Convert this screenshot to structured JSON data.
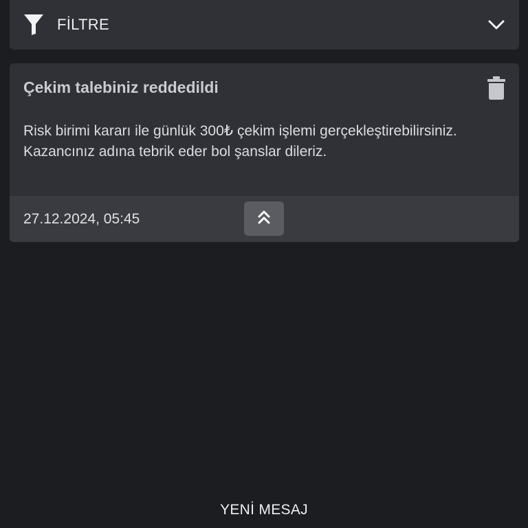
{
  "filter": {
    "label": "FİLTRE",
    "icon": "filter-icon",
    "toggle_icon": "chevron-down-icon"
  },
  "message": {
    "title": "Çekim talebiniz reddedildi",
    "body": "Risk birimi kararı ile günlük 300₺ çekim işlemi gerçekleştirebilirsiniz. Kazancınız adına tebrik eder bol şanslar dileriz.",
    "timestamp": "27.12.2024, 05:45",
    "delete_icon": "trash-icon",
    "collapse_icon": "double-chevron-up-icon"
  },
  "footer": {
    "new_message_label": "YENİ MESAJ"
  },
  "colors": {
    "background": "#1b1d21",
    "card": "#2f3136",
    "card_footer": "#393b40",
    "button": "#5a5c61"
  }
}
